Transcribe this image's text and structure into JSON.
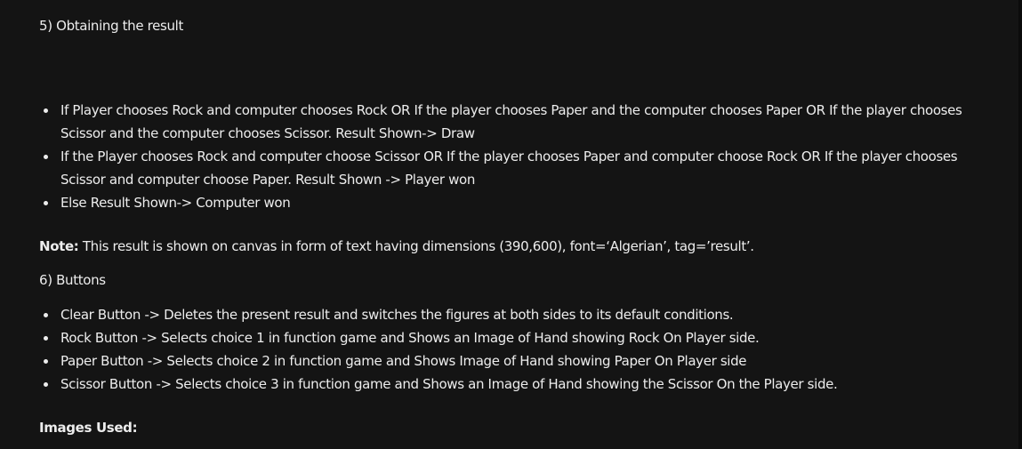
{
  "section5": {
    "heading": "5) Obtaining the result",
    "bullets": [
      "If Player chooses Rock and computer chooses Rock OR If the player chooses Paper and the computer chooses Paper OR If the player chooses Scissor and the computer chooses Scissor. Result Shown-> Draw",
      "If the Player chooses Rock and computer choose Scissor OR If the player chooses Paper and computer choose Rock OR If the player chooses Scissor and computer choose Paper.  Result Shown -> Player won",
      "Else Result Shown-> Computer won"
    ],
    "note_label": "Note:",
    "note_text": " This result is shown on canvas in form of text having dimensions (390,600), font=‘Algerian’, tag=’result’."
  },
  "section6": {
    "heading": "6) Buttons",
    "bullets": [
      "Clear Button -> Deletes the present result and switches the figures at both sides to its default conditions.",
      "Rock  Button -> Selects choice 1 in function game and Shows an Image of Hand showing Rock On Player side.",
      "Paper Button -> Selects choice 2 in function game and Shows Image of Hand showing Paper On Player side",
      "Scissor Button -> Selects choice 3 in function game and Shows an Image of Hand showing the Scissor On the Player side."
    ]
  },
  "images_used": "Images Used:"
}
